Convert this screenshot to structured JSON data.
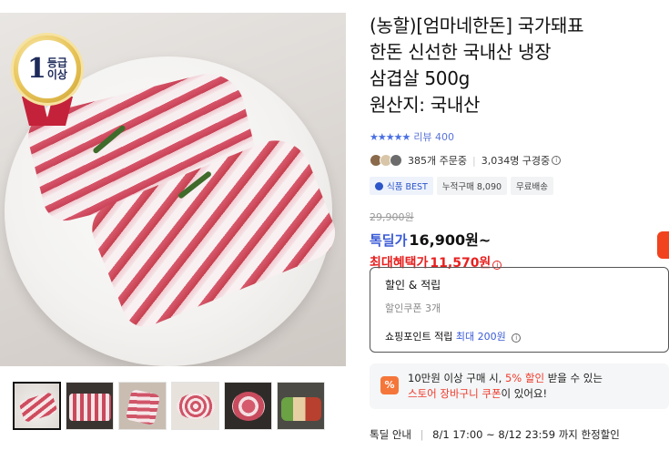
{
  "badge": {
    "number": "1",
    "line1": "등급",
    "line2": "이상"
  },
  "product": {
    "title_lines": [
      "(농할)[엄마네한돈] 국가돼표",
      "한돈 신선한 국내산 냉장",
      "삼겹살 500g",
      "원산지: 국내산"
    ],
    "rating_stars": "★★★★★",
    "review_label": "리뷰 400",
    "orders": "385개 주문중",
    "viewers": "3,034명 구경중",
    "tags": [
      "식품 BEST",
      "누적구매 8,090",
      "무료배송"
    ],
    "price_original": "29,900원",
    "price_label": "톡딜가",
    "price": "16,900원~",
    "max_label": "최대혜택가",
    "max_price": "11,570원"
  },
  "discount": {
    "title": "할인 & 적립",
    "coupon": "할인쿠폰 3개",
    "point_prefix": "쇼핑포인트 적립",
    "point_max": "최대 200원"
  },
  "promo": {
    "icon": "%",
    "line1_a": "10만원 이상 구매 시,",
    "line1_em": "5% 할인",
    "line1_b": "받을 수 있는",
    "line2_em": "스토어 장바구니 쿠폰",
    "line2_b": "이 있어요!"
  },
  "deal": {
    "label": "톡딜 안내",
    "period": "8/1 17:00 ~ 8/12 23:59 까지 한정할인"
  },
  "colors": {
    "accent_blue": "#3a5bd7",
    "accent_red": "#e8201f",
    "promo_orange": "#f5763a"
  },
  "icons": [
    "gold-grade-badge-icon",
    "star-icon",
    "info-icon",
    "best-icon",
    "percent-icon"
  ]
}
